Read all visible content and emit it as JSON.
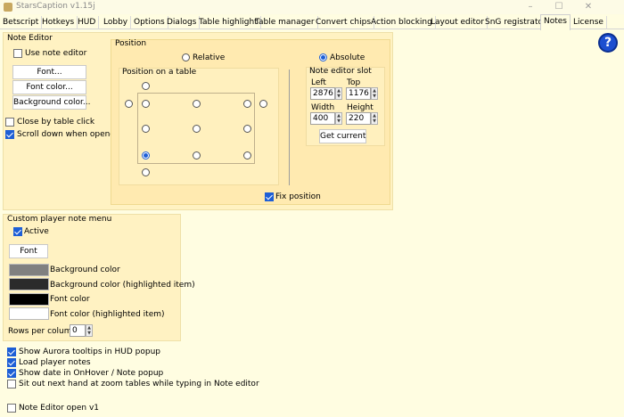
{
  "window": {
    "title": "StarsCaption v1.15j",
    "minimize": "–",
    "maximize": "☐",
    "close": "✕"
  },
  "tabs": [
    "Betscript",
    "Hotkeys",
    "HUD",
    "Lobby",
    "Options",
    "Dialogs",
    "Table highlight",
    "Table manager",
    "Convert chips",
    "Action blocking",
    "Layout editor",
    "SnG registrator",
    "Notes",
    "License"
  ],
  "active_tab": "Notes",
  "help_icon": "?",
  "note_editor": {
    "group_title": "Note Editor",
    "use_note_editor": "Use note editor",
    "font_button": "Font...",
    "font_color_button": "Font color...",
    "background_color_button": "Background color...",
    "close_by_table_click": "Close by table click",
    "scroll_down_when_opened": "Scroll down when opened"
  },
  "position": {
    "group_title": "Position",
    "relative": "Relative",
    "absolute": "Absolute",
    "on_table_title": "Position on a table",
    "fix_position": "Fix position"
  },
  "slot": {
    "title": "Note editor slot",
    "left_label": "Left",
    "left_value": "2876",
    "top_label": "Top",
    "top_value": "1176",
    "width_label": "Width",
    "width_value": "400",
    "height_label": "Height",
    "height_value": "220",
    "get_current": "Get current"
  },
  "custom_menu": {
    "group_title": "Custom player note menu",
    "active": "Active",
    "font_button": "Font",
    "background_color": "Background color",
    "background_color_highlighted": "Background color (highlighted item)",
    "font_color": "Font color",
    "font_color_highlighted": "Font color (highlighted item)",
    "rows_per_column": "Rows per column",
    "rows_value": "0",
    "swatch_colors": [
      "#808080",
      "#2b2b2b",
      "#000000",
      "#ffffff"
    ]
  },
  "options": {
    "show_aurora": "Show Aurora tooltips in HUD popup",
    "load_player_notes": "Load player notes",
    "show_date": "Show date in OnHover / Note popup",
    "sit_out": "Sit out next hand at zoom tables while typing in Note editor",
    "note_editor_open": "Note Editor open v1"
  }
}
